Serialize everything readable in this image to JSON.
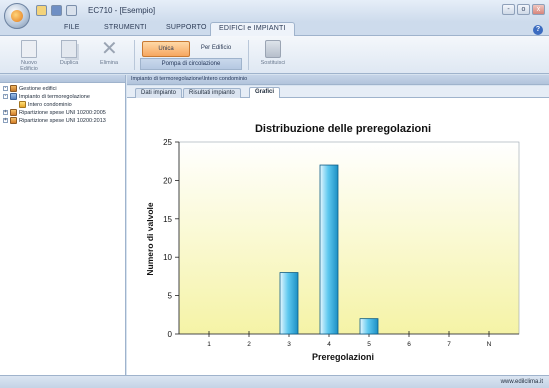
{
  "app": {
    "window_title": "EC710 - [Esempio]",
    "close_glyph": "x",
    "minimize_glyph": "-",
    "maximize_glyph": "o"
  },
  "ribbon_tabs": [
    "FILE",
    "STRUMENTI",
    "SUPPORTO",
    "EDIFICI e IMPIANTI"
  ],
  "ribbon": {
    "nuovo_label": "Nuovo Edificio",
    "duplica_label": "Duplica",
    "elimina_label": "Elimina",
    "unica_label": "Unica",
    "per_edificio_label": "Per Edificio",
    "group_label": "Pompa di circolazione",
    "sostituisci_label": "Sostituisci"
  },
  "tree": {
    "items": [
      {
        "label": "Gestione edifici",
        "icon": "buildings-icon"
      },
      {
        "label": "Impianto di termoregolazione",
        "icon": "heating-system-icon"
      },
      {
        "label": "Intero condominio",
        "icon": "condominium-icon"
      },
      {
        "label": "Ripartizione spese UNI 10200:2005",
        "icon": "cost-split-icon"
      },
      {
        "label": "Ripartizione spese UNI 10200:2013",
        "icon": "cost-split-icon"
      }
    ]
  },
  "main": {
    "breadcrumb": "Impianto di termoregolazione\\Intero condominio",
    "tabs": [
      "Dati impianto",
      "Risultati impianto",
      "Grafici"
    ],
    "active_tab": "Grafici"
  },
  "chart_data": {
    "type": "bar",
    "title": "Distribuzione delle preregolazioni",
    "xlabel": "Preregolazioni",
    "ylabel": "Numero di valvole",
    "categories": [
      "1",
      "2",
      "3",
      "4",
      "5",
      "6",
      "7",
      "N"
    ],
    "values": [
      0,
      0,
      8,
      22,
      2,
      0,
      0,
      0
    ],
    "ylim": [
      0,
      25
    ],
    "yticks": [
      0,
      5,
      10,
      15,
      20,
      25
    ],
    "grid": false,
    "bar_color": "#5ec8ef",
    "plot_background": [
      "#ffffff",
      "#f5f3a6"
    ]
  },
  "status": {
    "url": "www.edilclima.it"
  }
}
